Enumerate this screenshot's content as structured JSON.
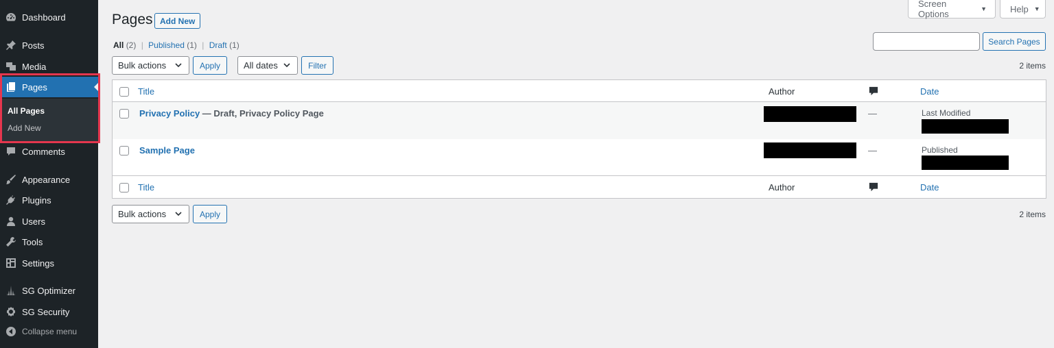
{
  "sidebar": {
    "items": [
      {
        "label": "Dashboard",
        "icon": "dashboard-icon"
      },
      {
        "label": "Posts",
        "icon": "pin-icon"
      },
      {
        "label": "Media",
        "icon": "media-icon"
      },
      {
        "label": "Pages",
        "icon": "pages-icon"
      },
      {
        "label": "Comments",
        "icon": "comment-icon"
      },
      {
        "label": "Appearance",
        "icon": "brush-icon"
      },
      {
        "label": "Plugins",
        "icon": "plugin-icon"
      },
      {
        "label": "Users",
        "icon": "user-icon"
      },
      {
        "label": "Tools",
        "icon": "wrench-icon"
      },
      {
        "label": "Settings",
        "icon": "settings-icon"
      },
      {
        "label": "SG Optimizer",
        "icon": "sg-optimizer-icon"
      },
      {
        "label": "SG Security",
        "icon": "sg-security-icon"
      }
    ],
    "submenu": [
      {
        "label": "All Pages"
      },
      {
        "label": "Add New"
      }
    ],
    "collapse_label": "Collapse menu",
    "highlight_color": "#e5364e",
    "active_color": "#2271b1"
  },
  "top": {
    "screen_options": "Screen Options",
    "help": "Help"
  },
  "header": {
    "title": "Pages",
    "add_new": "Add New"
  },
  "filters": {
    "all": "All",
    "all_count": "(2)",
    "published": "Published",
    "published_count": "(1)",
    "draft": "Draft",
    "draft_count": "(1)",
    "separator": "|"
  },
  "search": {
    "button": "Search Pages",
    "value": ""
  },
  "controls": {
    "bulk_actions": "Bulk actions",
    "apply": "Apply",
    "all_dates": "All dates",
    "filter": "Filter",
    "items_count": "2 items"
  },
  "table": {
    "columns": {
      "title": "Title",
      "author": "Author",
      "date": "Date"
    },
    "rows": [
      {
        "title": "Privacy Policy",
        "state": " — Draft, Privacy Policy Page",
        "comments": "—",
        "date_status": "Last Modified"
      },
      {
        "title": "Sample Page",
        "state": "",
        "comments": "—",
        "date_status": "Published"
      }
    ]
  }
}
